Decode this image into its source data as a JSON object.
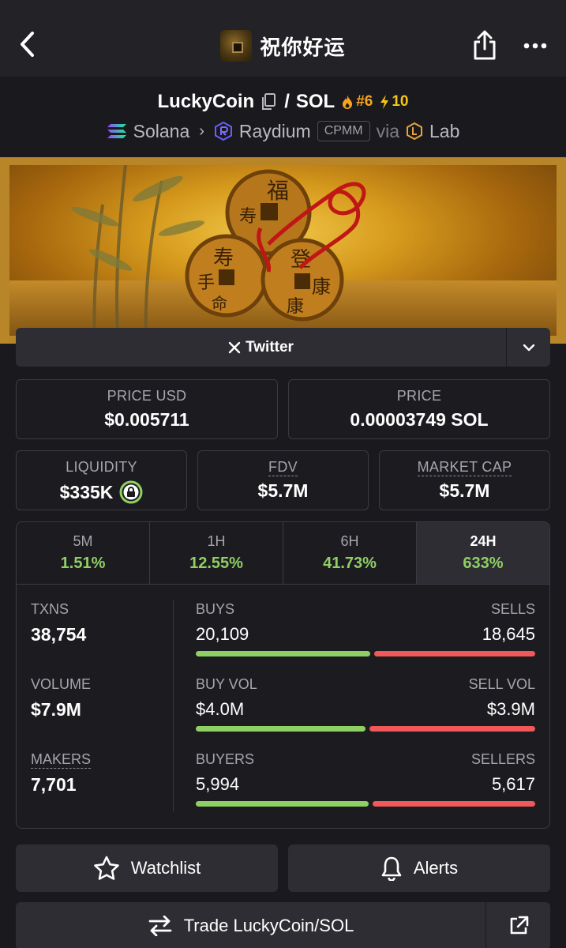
{
  "header": {
    "title": "祝你好运",
    "icons": {
      "back": "chevron-left-icon",
      "share": "share-icon",
      "more": "more-horizontal-icon"
    }
  },
  "pair": {
    "base": "LuckyCoin",
    "separator": "/",
    "quote": "SOL",
    "rank": "#6",
    "boosts": "10"
  },
  "chain": {
    "network": "Solana",
    "dex": "Raydium",
    "pool_type": "CPMM",
    "via_label": "via",
    "launchpad": "Lab"
  },
  "social": {
    "twitter_label": "Twitter"
  },
  "prices": {
    "price_usd_label": "PRICE USD",
    "price_usd": "$0.005711",
    "price_native_label": "PRICE",
    "price_native": "0.00003749 SOL"
  },
  "metrics": {
    "liquidity_label": "LIQUIDITY",
    "liquidity": "$335K",
    "fdv_label": "FDV",
    "fdv": "$5.7M",
    "mcap_label": "MARKET CAP",
    "mcap": "$5.7M"
  },
  "timeframes": [
    {
      "label": "5M",
      "change": "1.51%"
    },
    {
      "label": "1H",
      "change": "12.55%"
    },
    {
      "label": "6H",
      "change": "41.73%"
    },
    {
      "label": "24H",
      "change": "633%"
    }
  ],
  "active_timeframe": "24H",
  "stats": {
    "txns_label": "TXNS",
    "txns": "38,754",
    "volume_label": "VOLUME",
    "volume": "$7.9M",
    "makers_label": "MAKERS",
    "makers": "7,701",
    "buys_label": "BUYS",
    "buys": "20,109",
    "sells_label": "SELLS",
    "sells": "18,645",
    "buy_vol_label": "BUY VOL",
    "buy_vol": "$4.0M",
    "sell_vol_label": "SELL VOL",
    "sell_vol": "$3.9M",
    "buyers_label": "BUYERS",
    "buyers": "5,994",
    "sellers_label": "SELLERS",
    "sellers": "5,617"
  },
  "ratios": {
    "buys_share": 0.519,
    "buy_vol_share": 0.506,
    "buyers_share": 0.516
  },
  "actions": {
    "watchlist": "Watchlist",
    "alerts": "Alerts",
    "trade": "Trade LuckyCoin/SOL"
  },
  "colors": {
    "background": "#1a1a1e",
    "panel": "#2d2d33",
    "positive": "#8ed063",
    "negative": "#f0585a",
    "rank": "#f7a51f"
  }
}
